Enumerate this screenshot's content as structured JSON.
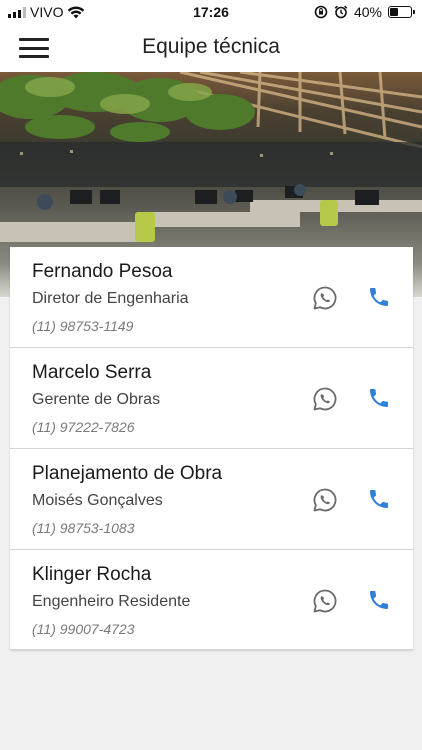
{
  "status": {
    "carrier": "VIVO",
    "time": "17:26",
    "battery": "40%",
    "battery_level": 0.4
  },
  "header": {
    "title": "Equipe técnica"
  },
  "contacts": [
    {
      "title": "Fernando Pesoa",
      "subtitle": "Diretor de Engenharia",
      "phone": "(11) 98753-1149"
    },
    {
      "title": "Marcelo Serra",
      "subtitle": "Gerente de Obras",
      "phone": "(11) 97222-7826"
    },
    {
      "title": "Planejamento de Obra",
      "subtitle": "Moisés Gonçalves",
      "phone": "(11) 98753-1083"
    },
    {
      "title": "Klinger Rocha",
      "subtitle": "Engenheiro Residente",
      "phone": "(11) 99007-4723"
    }
  ],
  "icons": {
    "menu": "hamburger-menu-icon",
    "whatsapp": "whatsapp-icon",
    "call": "phone-icon",
    "wifi": "wifi-icon",
    "lock": "rotation-lock-icon",
    "alarm": "alarm-icon"
  },
  "colors": {
    "call_icon": "#2f80d8",
    "whatsapp_icon": "#6a6a6a"
  }
}
